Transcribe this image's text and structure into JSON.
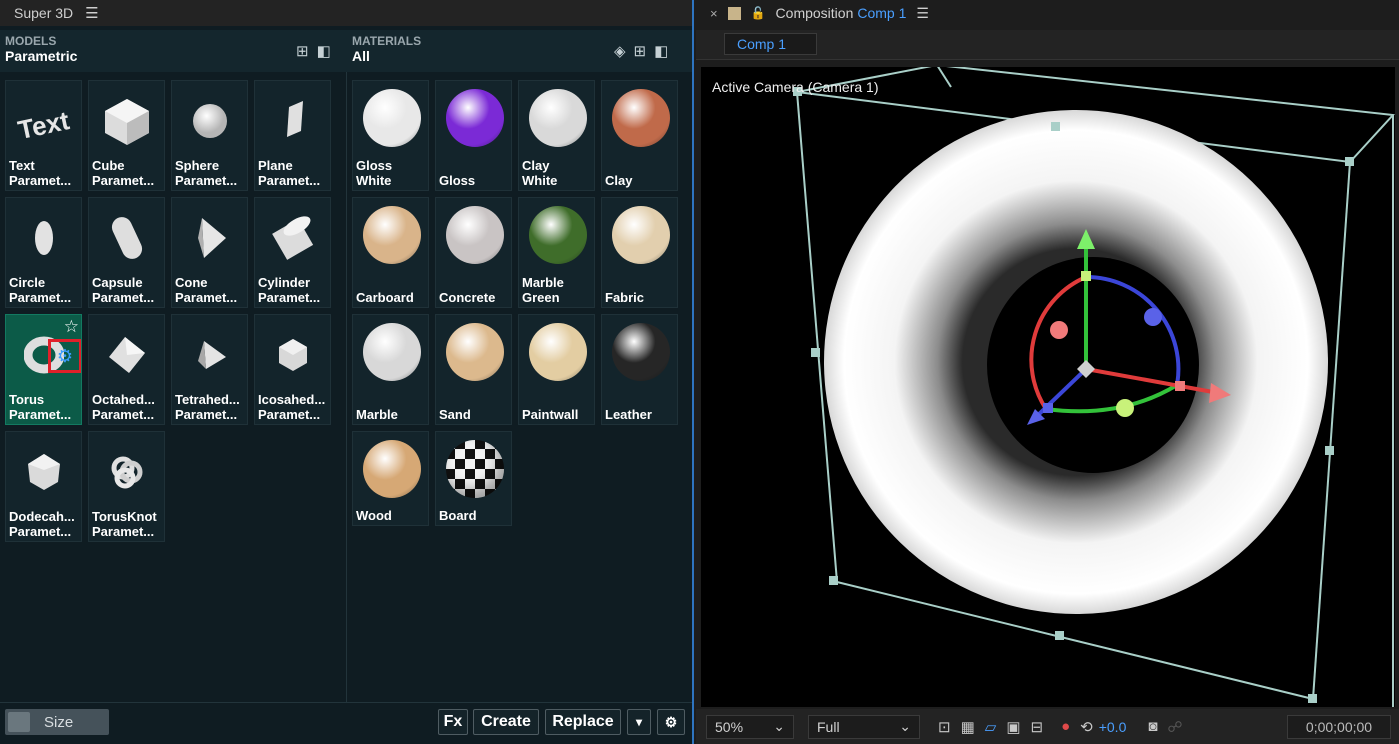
{
  "left_panel": {
    "title": "Super 3D",
    "models": {
      "caption": "MODELS",
      "category": "Parametric"
    },
    "materials": {
      "caption": "MATERIALS",
      "category": "All"
    },
    "model_items": [
      {
        "name": "Text",
        "sub": "Paramet..."
      },
      {
        "name": "Cube",
        "sub": "Paramet..."
      },
      {
        "name": "Sphere",
        "sub": "Paramet..."
      },
      {
        "name": "Plane",
        "sub": "Paramet..."
      },
      {
        "name": "Circle",
        "sub": "Paramet..."
      },
      {
        "name": "Capsule",
        "sub": "Paramet..."
      },
      {
        "name": "Cone",
        "sub": "Paramet..."
      },
      {
        "name": "Cylinder",
        "sub": "Paramet..."
      },
      {
        "name": "Torus",
        "sub": "Paramet..."
      },
      {
        "name": "Octahed...",
        "sub": "Paramet..."
      },
      {
        "name": "Tetrahed...",
        "sub": "Paramet..."
      },
      {
        "name": "Icosahed...",
        "sub": "Paramet..."
      },
      {
        "name": "Dodecah...",
        "sub": "Paramet..."
      },
      {
        "name": "TorusKnot",
        "sub": "Paramet..."
      }
    ],
    "material_items": [
      {
        "name": "Gloss",
        "sub": "White",
        "color": "#e8e8e8"
      },
      {
        "name": "Gloss",
        "sub": "",
        "color": "#7b2ad6"
      },
      {
        "name": "Clay",
        "sub": "White",
        "color": "#d9d9d9"
      },
      {
        "name": "Clay",
        "sub": "",
        "color": "#c06a4a"
      },
      {
        "name": "Carboard",
        "sub": "",
        "color": "#d9b48a"
      },
      {
        "name": "Concrete",
        "sub": "",
        "color": "#c9c4c4"
      },
      {
        "name": "Marble",
        "sub": "Green",
        "color": "#3f6d2a"
      },
      {
        "name": "Fabric",
        "sub": "",
        "color": "#e2cfae"
      },
      {
        "name": "Marble",
        "sub": "",
        "color": "#d8d8d8"
      },
      {
        "name": "Sand",
        "sub": "",
        "color": "#dcb98d"
      },
      {
        "name": "Paintwall",
        "sub": "",
        "color": "#e3cda2"
      },
      {
        "name": "Leather",
        "sub": "",
        "color": "#262626"
      },
      {
        "name": "Wood",
        "sub": "",
        "color": "#d6a875"
      },
      {
        "name": "Board",
        "sub": "",
        "color": "#ffffff"
      }
    ],
    "size_label": "Size",
    "fx_label": "Fx",
    "create_label": "Create",
    "replace_label": "Replace",
    "dropdown_label": "▾",
    "settings_label": "⚙"
  },
  "right_panel": {
    "close": "×",
    "composition_label": "Composition",
    "comp_name": "Comp 1",
    "tab_label": "Comp 1",
    "camera_label": "Active Camera (Camera 1)",
    "zoom": "50%",
    "resolution": "Full",
    "exposure": "+0.0",
    "timecode": "0;00;00;00"
  }
}
